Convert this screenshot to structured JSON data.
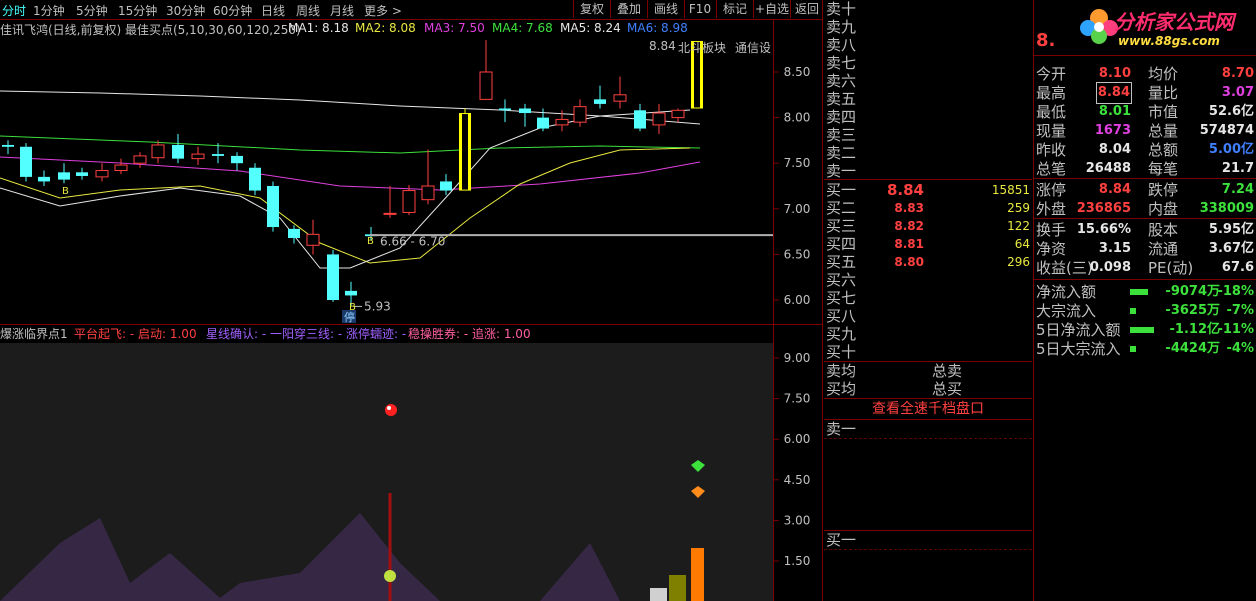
{
  "toolbar": {
    "periods": [
      "分时",
      "1分钟",
      "5分钟",
      "15分钟",
      "30分钟",
      "60分钟",
      "日线",
      "周线",
      "月线",
      "更多 >"
    ],
    "buttons": [
      "复权",
      "叠加",
      "画线",
      "F10",
      "标记",
      "+自选",
      "返回"
    ]
  },
  "ma_legend": {
    "stock": "佳讯飞鸿(日线,前复权) 最佳买点(5,10,30,60,120,250)",
    "ma1": "MA1: 8.18",
    "ma2": "MA2: 8.08",
    "ma3": "MA3: 7.50",
    "ma4": "MA4: 7.68",
    "ma5": "MA5: 8.24",
    "ma6": "MA6: 8.98"
  },
  "chart_labels": {
    "top_price": "8.84",
    "block": "北斗板块",
    "tongxin": "通信设",
    "low_range": "6.66 - 6.70",
    "low_point": "5.93",
    "b_marker": "B",
    "stop_marker": "停"
  },
  "main_axis": [
    "8.50",
    "8.00",
    "7.50",
    "7.00",
    "6.50",
    "6.00"
  ],
  "indicator_axis": [
    "9.00",
    "7.50",
    "6.00",
    "4.50",
    "3.00",
    "1.50"
  ],
  "indicator_legend": {
    "name": "爆涨临界点1",
    "item1": "平台起飞: - 启动: 1.00",
    "item2": "星线确认: - 一阳穿三线: - 涨停蠕迹: -",
    "item3": "稳操胜券: - 追涨: 1.00"
  },
  "order_book": {
    "sells": [
      "卖十",
      "卖九",
      "卖八",
      "卖七",
      "卖六",
      "卖五",
      "卖四",
      "卖三",
      "卖二",
      "卖一"
    ],
    "buys": [
      {
        "label": "买一",
        "price": "8.84",
        "vol": "15851"
      },
      {
        "label": "买二",
        "price": "8.83",
        "vol": "259"
      },
      {
        "label": "买三",
        "price": "8.82",
        "vol": "122"
      },
      {
        "label": "买四",
        "price": "8.81",
        "vol": "64"
      },
      {
        "label": "买五",
        "price": "8.80",
        "vol": "296"
      },
      {
        "label": "买六",
        "price": "",
        "vol": ""
      },
      {
        "label": "买七",
        "price": "",
        "vol": ""
      },
      {
        "label": "买八",
        "price": "",
        "vol": ""
      },
      {
        "label": "买九",
        "price": "",
        "vol": ""
      },
      {
        "label": "买十",
        "price": "",
        "vol": ""
      }
    ],
    "sell_avg": "卖均",
    "buy_avg": "买均",
    "total_sell": "总卖",
    "total_buy": "总买",
    "fast_link": "查看全速千档盘口",
    "mini_sell": "卖一",
    "mini_buy": "买一"
  },
  "logo": {
    "title": "分析家公式网",
    "url": "www.88gs.com"
  },
  "info": {
    "current_price_partial": "8.",
    "rows": [
      {
        "l1": "今开",
        "v1": "8.10",
        "c1": "red",
        "l2": "均价",
        "v2": "8.70",
        "c2": "red"
      },
      {
        "l1": "最高",
        "v1": "8.84",
        "c1": "red",
        "l2": "量比",
        "v2": "3.07",
        "c2": "purple"
      },
      {
        "l1": "最低",
        "v1": "8.01",
        "c1": "green",
        "l2": "市值",
        "v2": "52.6亿",
        "c2": "white"
      },
      {
        "l1": "现量",
        "v1": "1673",
        "c1": "purple",
        "l2": "总量",
        "v2": "574874",
        "c2": "white"
      },
      {
        "l1": "昨收",
        "v1": "8.04",
        "c1": "white",
        "l2": "总额",
        "v2": "5.00亿",
        "c2": "blue"
      },
      {
        "l1": "总笔",
        "v1": "26488",
        "c1": "white",
        "l2": "每笔",
        "v2": "21.7",
        "c2": "white"
      },
      {
        "l1": "涨停",
        "v1": "8.84",
        "c1": "red",
        "l2": "跌停",
        "v2": "7.24",
        "c2": "green"
      },
      {
        "l1": "外盘",
        "v1": "236865",
        "c1": "red",
        "l2": "内盘",
        "v2": "338009",
        "c2": "green"
      },
      {
        "l1": "换手",
        "v1": "15.66%",
        "c1": "white",
        "l2": "股本",
        "v2": "5.95亿",
        "c2": "white"
      },
      {
        "l1": "净资",
        "v1": "3.15",
        "c1": "white",
        "l2": "流通",
        "v2": "3.67亿",
        "c2": "white"
      },
      {
        "l1": "收益(三)",
        "v1": "0.098",
        "c1": "white",
        "l2": "PE(动)",
        "v2": "67.6",
        "c2": "white"
      }
    ],
    "flows": [
      {
        "label": "净流入额",
        "value": "-9074万",
        "pct": "-18%"
      },
      {
        "label": "大宗流入",
        "value": "-3625万",
        "pct": "-7%"
      },
      {
        "label": "5日净流入额",
        "value": "-1.12亿",
        "pct": "-11%"
      },
      {
        "label": "5日大宗流入",
        "value": "-4424万",
        "pct": "-4%"
      }
    ]
  },
  "colors": {
    "up": "#ff4040",
    "down": "#54ffff",
    "frame": "#7a0000",
    "limit_up": "#ffff00"
  }
}
